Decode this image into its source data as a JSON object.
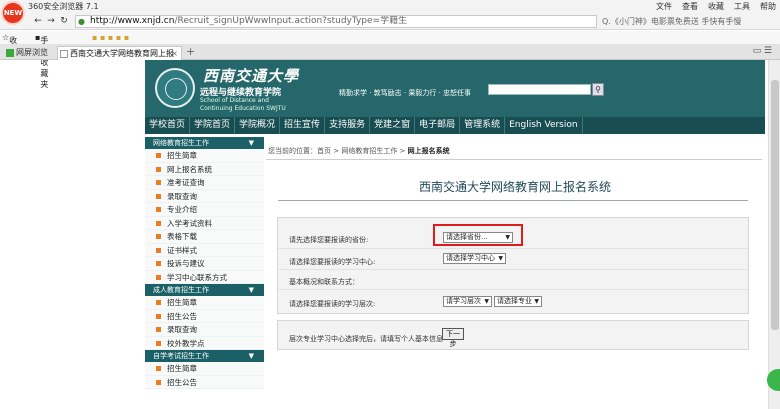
{
  "browser": {
    "badge": "NEW",
    "app_title": "360安全浏览器 7.1",
    "menu": [
      "文件",
      "查看",
      "收藏",
      "工具",
      "帮助"
    ],
    "url_host": "http://www.xnjd.cn",
    "url_path": "/Recruit_signUpWwwInput.action?studyType=学籍生",
    "search_text": "Q.《小门神》电影票免费送 手快有手慢",
    "bookmarks": [
      "收藏",
      "手机收藏夹"
    ],
    "tabs": [
      {
        "label": "网屏浏览"
      },
      {
        "label": "西南交通大学网络教育网上报"
      }
    ],
    "tab_close": "×",
    "tab_add": "+"
  },
  "header": {
    "logo_script": "西南交通大學",
    "logo_cn": "远程与继续教育学院",
    "logo_en_1": "School of Distance and",
    "logo_en_2": "Continuing  Education SWJTU",
    "motto": "精勤求学 · 敦笃励志 · 果毅力行 · 忠恕任事",
    "search_icon": "magnifier-icon"
  },
  "nav": [
    "学校首页",
    "学院首页",
    "学院概况",
    "招生宣传",
    "支持服务",
    "党建之窗",
    "电子邮局",
    "管理系统",
    "English Version"
  ],
  "sidebar": {
    "group1": {
      "title": "网络教育招生工作",
      "items": [
        "招生简章",
        "网上报名系统",
        "准考证查询",
        "录取查询",
        "专业介绍",
        "入学考试资料",
        "表格下载",
        "证书样式",
        "投诉与建议",
        "学习中心联系方式"
      ]
    },
    "group2": {
      "title": "成人教育招生工作",
      "items": [
        "招生简章",
        "招生公告",
        "录取查询",
        "校外教学点"
      ]
    },
    "group3": {
      "title": "自学考试招生工作",
      "items": [
        "招生简章",
        "招生公告"
      ]
    }
  },
  "breadcrumb": {
    "prefix": "您当前的位置：首页 > 网络教育招生工作 >",
    "current": "网上报名系统"
  },
  "page": {
    "title": "西南交通大学网络教育网上报名系统",
    "rows": {
      "province_label": "请先选择您要报读的省份:",
      "province_select": "请选择省份...",
      "center_label": "请选择您要报读的学习中心:",
      "center_select": "请选择学习中心",
      "basic_info_label": "基本概况和联系方式：",
      "level_label": "请选择您要报读的学习层次:",
      "level_select": "请学习层次",
      "major_select": "请选择专业"
    },
    "note": "层次专业学习中心选择完后，请填写个人基本信息",
    "next_button": "下一步"
  }
}
